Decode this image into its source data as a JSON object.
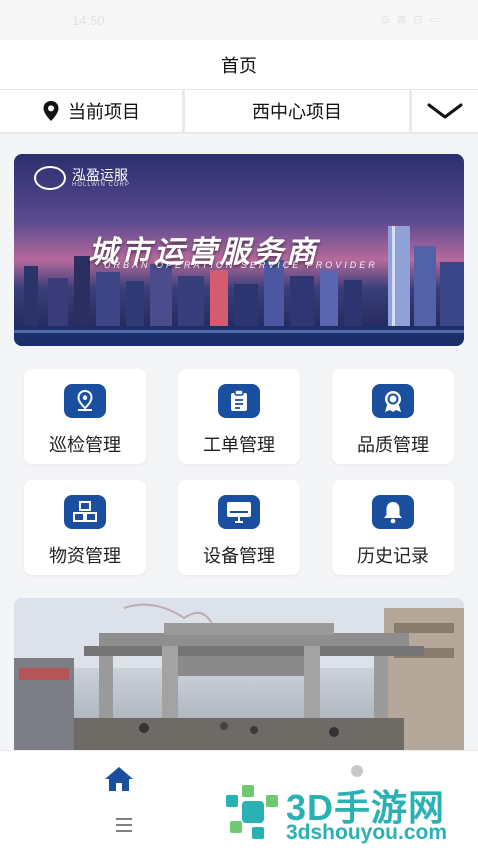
{
  "status": {
    "time": "14:50",
    "icons_text": "⊙ ⊠ ⊡ ▭"
  },
  "header": {
    "title": "首页"
  },
  "project": {
    "label": "当前项目",
    "value": "西中心项目"
  },
  "banner": {
    "logo_text": "泓盈运服",
    "logo_sub": "HOLLWIN CORP",
    "headline": "城市运营服务商",
    "subline": "URBAN OPERATION SERVICE PROVIDER"
  },
  "tiles": [
    {
      "label": "巡检管理",
      "icon": "location-pin-icon"
    },
    {
      "label": "工单管理",
      "icon": "clipboard-icon"
    },
    {
      "label": "品质管理",
      "icon": "award-badge-icon"
    },
    {
      "label": "物资管理",
      "icon": "boxes-icon"
    },
    {
      "label": "设备管理",
      "icon": "monitor-icon"
    },
    {
      "label": "历史记录",
      "icon": "bell-icon"
    }
  ],
  "colors": {
    "accent": "#1a4fa0",
    "watermark": "#2ab1b4"
  },
  "watermark": {
    "big": "3D手游网",
    "small": "3dshouyou.com"
  }
}
